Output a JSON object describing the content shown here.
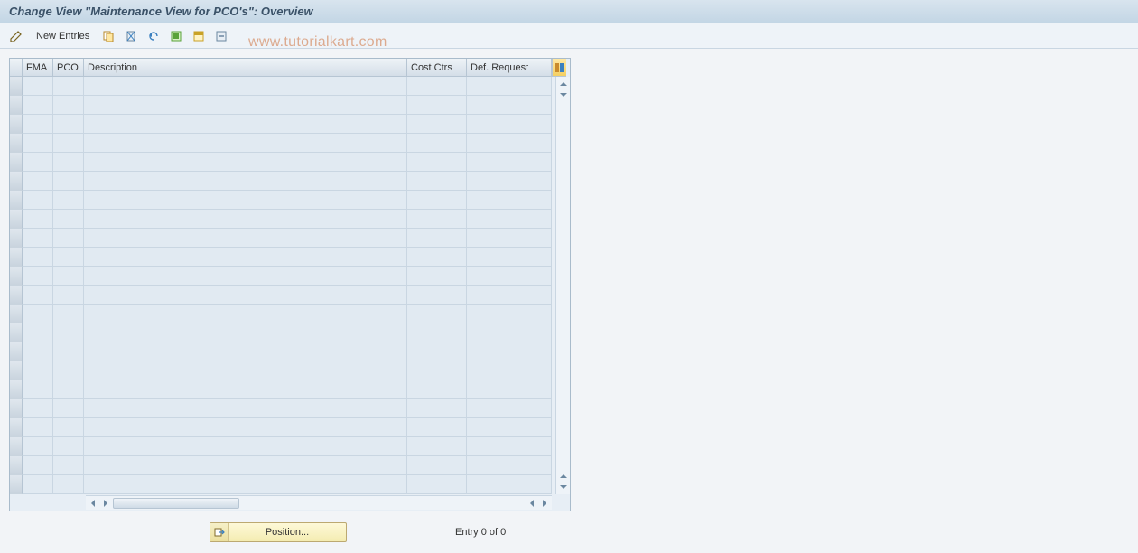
{
  "title": "Change View \"Maintenance View for PCO's\": Overview",
  "toolbar": {
    "new_entries_label": "New Entries"
  },
  "watermark": "www.tutorialkart.com",
  "table": {
    "columns": {
      "fma": "FMA",
      "pco": "PCO",
      "description": "Description",
      "cost_ctrs": "Cost Ctrs",
      "def_request": "Def. Request"
    },
    "rows": []
  },
  "footer": {
    "position_label": "Position...",
    "entry_text": "Entry 0 of 0"
  }
}
